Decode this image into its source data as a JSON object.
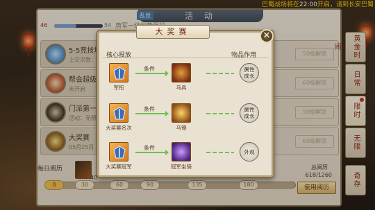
{
  "marquee": {
    "prefix": "巴蜀战场将在",
    "time": "22:00",
    "suffix": "开启，请到长安巴蜀"
  },
  "activity": {
    "tag": "乱世",
    "title": "活 动",
    "progress_left": "46",
    "progress_right": "54",
    "progress_fraction": 0.46,
    "note": "唐军一级剑势保护",
    "items": [
      {
        "title": "5-5竞技场",
        "sub": "上交次数：0",
        "icon": "crystal-icon",
        "btn": "50级解锁"
      },
      {
        "title": "帮会超级",
        "sub": "未开启",
        "icon": "shield-icon",
        "btn": "60级解锁"
      },
      {
        "title": "门派第一",
        "sub": "活动：无限",
        "icon": "fighter-icon",
        "btn": "50级解锁"
      },
      {
        "title": "大奖赛",
        "sub": "05月25日 下",
        "icon": "trophy-icon",
        "btn": "60级解锁"
      }
    ],
    "daily_label": "每日阅历",
    "daily_value": "40",
    "ticks": [
      "0",
      "30",
      "60",
      "90",
      "135",
      "180"
    ],
    "total_label": "总阅历",
    "total_value": "618/1260",
    "use_button": "使用阅历"
  },
  "side_tabs": [
    {
      "label": "黄金时间",
      "selected": false
    },
    {
      "label": "日常",
      "selected": false
    },
    {
      "label": "限时",
      "selected": true,
      "badge": true
    },
    {
      "label": "无限",
      "selected": false
    },
    {
      "label": "奇存",
      "selected": false
    }
  ],
  "modal": {
    "title": "大奖赛",
    "close": "✕",
    "col_core": "核心投放",
    "col_effect": "物品作用",
    "rows": [
      {
        "core_label": "军衔",
        "cond": "条件",
        "item_label": "马具",
        "effect_line1": "属性",
        "effect_line2": "成长"
      },
      {
        "core_label": "大奖赛名次",
        "cond": "条件",
        "item_label": "马镫",
        "effect_line1": "属性",
        "effect_line2": "成长"
      },
      {
        "core_label": "大奖赛冠军",
        "cond": "条件",
        "item_label": "冠军坐骑",
        "effect_line1": "外观",
        "effect_line2": ""
      }
    ]
  },
  "colors": {
    "accent_red": "#8b1e12",
    "arrow_green": "#6ec24f",
    "marquee_yellow": "#ffd200"
  }
}
